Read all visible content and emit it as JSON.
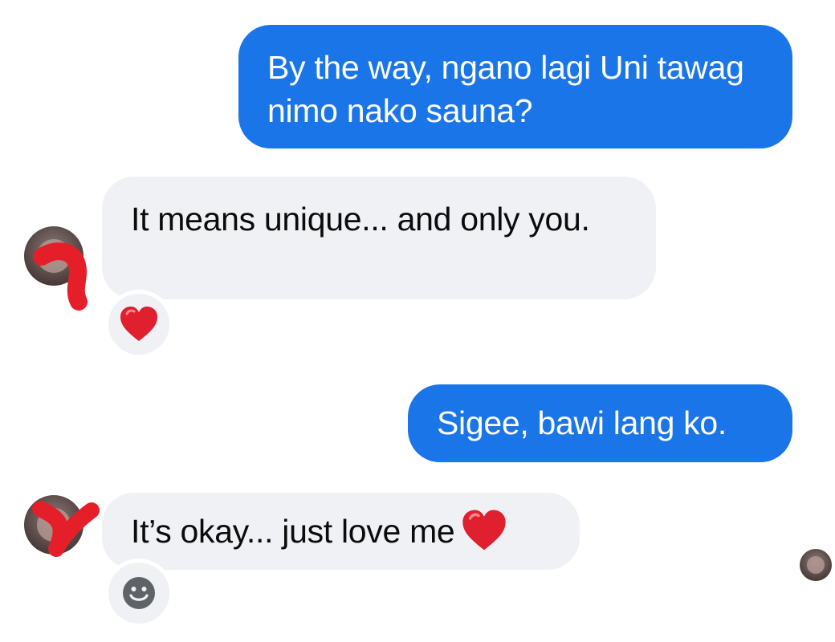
{
  "messages": [
    {
      "direction": "sent",
      "text": "By the way, ngano lagi Uni tawag nimo nako sauna?"
    },
    {
      "direction": "received",
      "text": "It means unique... and only you.",
      "reaction": "red-heart-icon"
    },
    {
      "direction": "sent",
      "text": "Sigee, bawi lang ko."
    },
    {
      "direction": "received",
      "text": "It’s okay... just love me",
      "trailing_emoji": "red-heart-icon"
    }
  ],
  "icons": {
    "reaction": "red-heart-icon",
    "add_reaction": "smiley-icon",
    "seen_indicator": "avatar"
  },
  "colors": {
    "sent_bubble": "#1a76e8",
    "received_bubble": "#eff1f5",
    "heart": "#e0202e",
    "redaction_scribble": "#e41f2a"
  }
}
